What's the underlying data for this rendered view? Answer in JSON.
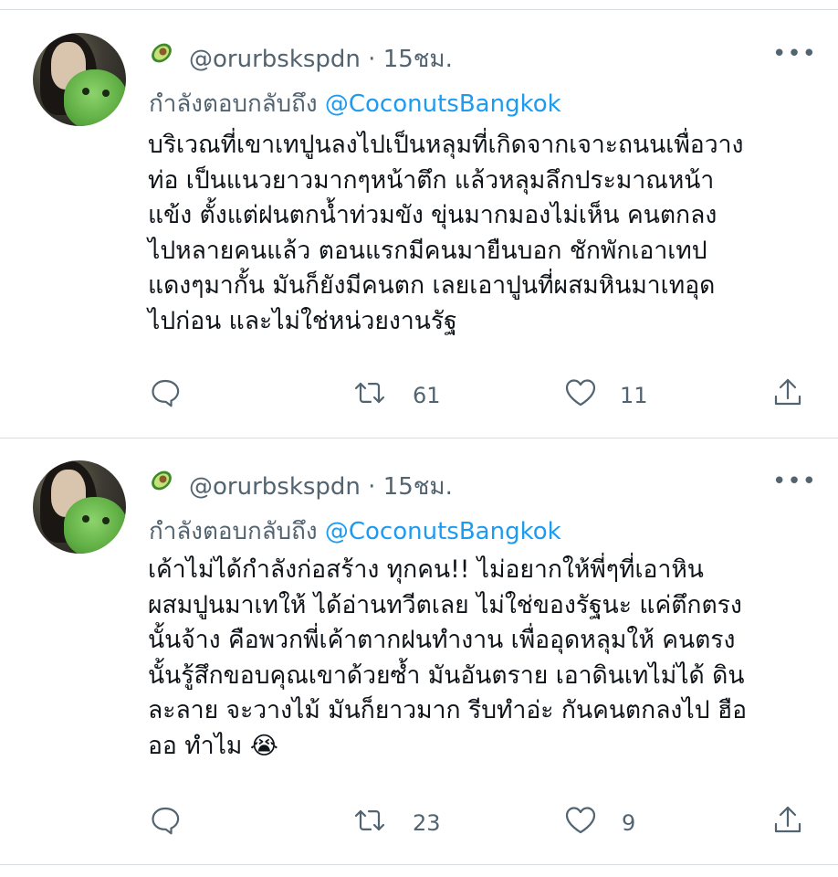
{
  "tweets": [
    {
      "avatar_icon": "avatar",
      "name_icon": "avocado-icon",
      "handle": "@orurbskspdn",
      "separator": "·",
      "time": "15ชม.",
      "more_label": "•••",
      "replying_prefix": "กำลังตอบกลับถึง",
      "replying_to": "@CoconutsBangkok",
      "text": "บริเวณที่เขาเทปูนลงไปเป็นหลุมที่เกิดจากเจาะถนนเพื่อวาง\nท่อ เป็นแนวยาวมากๆหน้าตึก แล้วหลุมลึกประมาณหน้า\nแข้ง  ตั้งแต่ฝนตกน้ำท่วมขัง ขุ่นมากมองไม่เห็น คนตกลง\nไปหลายคนแล้ว ตอนแรกมีคนมายืนบอก ชักพักเอาเทป\nแดงๆมากั้น มันก็ยังมีคนตก เลยเอาปูนที่ผสมหินมาเทอุด\nไปก่อน และไม่ใช่หน่วยงานรัฐ",
      "retweets": "61",
      "likes": "11"
    },
    {
      "avatar_icon": "avatar",
      "name_icon": "avocado-icon",
      "handle": "@orurbskspdn",
      "separator": "·",
      "time": "15ชม.",
      "more_label": "•••",
      "replying_prefix": "กำลังตอบกลับถึง",
      "replying_to": "@CoconutsBangkok",
      "text": "เค้าไม่ได้กำลังก่อสร้าง ทุกคน!! ไม่อยากให้พี่ๆที่เอาหิน\nผสมปูนมาเทให้ ได้อ่านทวีตเลย ไม่ใช่ของรัฐนะ แค่ตึกตรง\nนั้นจ้าง คือพวกพี่เค้าตากฝนทำงาน เพื่ออุดหลุมให้ คนตรง\nนั้นรู้สึกขอบคุณเขาด้วยซ้ำ มันอันตราย เอาดินเทไม่ได้ ดิน\nละลาย จะวางไม้ มันก็ยาวมาก รีบทำอ่ะ กันคนตกลงไป ฮือ\nออ ทำไม 😭",
      "retweets": "23",
      "likes": "9"
    }
  ],
  "colors": {
    "text": "#0f1419",
    "secondary": "#536471",
    "link": "#1d9bf0",
    "divider": "#d6dde2"
  }
}
